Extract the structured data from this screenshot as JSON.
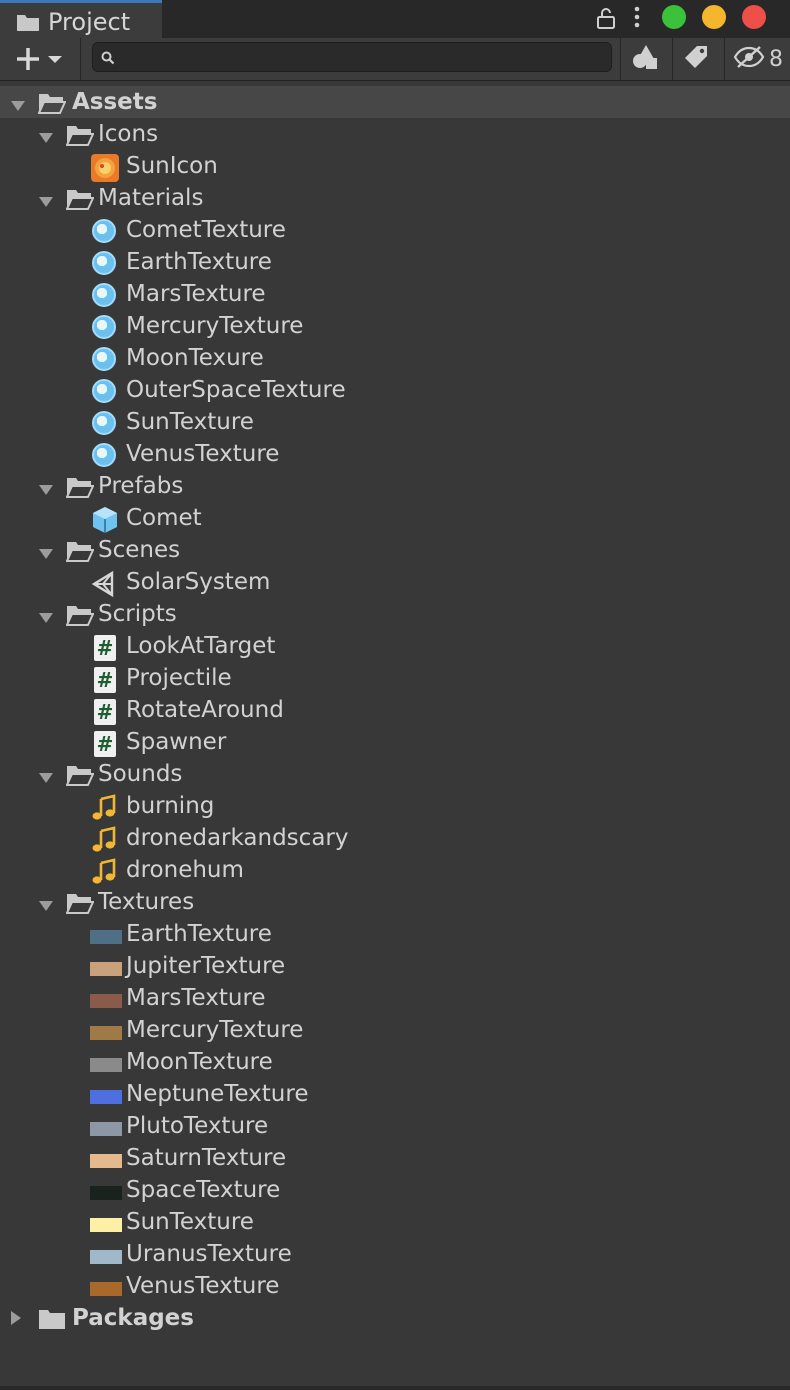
{
  "window": {
    "tab_title": "Project",
    "traffic_colors": {
      "green": "#3cc13b",
      "yellow": "#f5b62d",
      "red": "#ee4f48"
    }
  },
  "toolbar": {
    "search_placeholder": "",
    "hidden_count": "8"
  },
  "tree": [
    {
      "label": "Assets",
      "depth": 0,
      "kind": "folder",
      "expanded": true,
      "bold": true
    },
    {
      "label": "Icons",
      "depth": 1,
      "kind": "folder",
      "expanded": true
    },
    {
      "label": "SunIcon",
      "depth": 2,
      "kind": "image-icon"
    },
    {
      "label": "Materials",
      "depth": 1,
      "kind": "folder",
      "expanded": true
    },
    {
      "label": "CometTexture",
      "depth": 2,
      "kind": "material"
    },
    {
      "label": "EarthTexture",
      "depth": 2,
      "kind": "material"
    },
    {
      "label": "MarsTexture",
      "depth": 2,
      "kind": "material"
    },
    {
      "label": "MercuryTexture",
      "depth": 2,
      "kind": "material"
    },
    {
      "label": "MoonTexure",
      "depth": 2,
      "kind": "material"
    },
    {
      "label": "OuterSpaceTexture",
      "depth": 2,
      "kind": "material"
    },
    {
      "label": "SunTexture",
      "depth": 2,
      "kind": "material"
    },
    {
      "label": "VenusTexture",
      "depth": 2,
      "kind": "material"
    },
    {
      "label": "Prefabs",
      "depth": 1,
      "kind": "folder",
      "expanded": true
    },
    {
      "label": "Comet",
      "depth": 2,
      "kind": "prefab"
    },
    {
      "label": "Scenes",
      "depth": 1,
      "kind": "folder",
      "expanded": true
    },
    {
      "label": "SolarSystem",
      "depth": 2,
      "kind": "scene"
    },
    {
      "label": "Scripts",
      "depth": 1,
      "kind": "folder",
      "expanded": true
    },
    {
      "label": "LookAtTarget",
      "depth": 2,
      "kind": "script"
    },
    {
      "label": "Projectile",
      "depth": 2,
      "kind": "script"
    },
    {
      "label": "RotateAround",
      "depth": 2,
      "kind": "script"
    },
    {
      "label": "Spawner",
      "depth": 2,
      "kind": "script"
    },
    {
      "label": "Sounds",
      "depth": 1,
      "kind": "folder",
      "expanded": true
    },
    {
      "label": "burning",
      "depth": 2,
      "kind": "audio"
    },
    {
      "label": "dronedarkandscary",
      "depth": 2,
      "kind": "audio"
    },
    {
      "label": "dronehum",
      "depth": 2,
      "kind": "audio"
    },
    {
      "label": "Textures",
      "depth": 1,
      "kind": "folder",
      "expanded": true
    },
    {
      "label": "EarthTexture",
      "depth": 2,
      "kind": "texture",
      "color": "#4f6f86"
    },
    {
      "label": "JupiterTexture",
      "depth": 2,
      "kind": "texture",
      "color": "#c9a27c"
    },
    {
      "label": "MarsTexture",
      "depth": 2,
      "kind": "texture",
      "color": "#8a5a4a"
    },
    {
      "label": "MercuryTexture",
      "depth": 2,
      "kind": "texture",
      "color": "#a07a46"
    },
    {
      "label": "MoonTexture",
      "depth": 2,
      "kind": "texture",
      "color": "#8a8a8a"
    },
    {
      "label": "NeptuneTexture",
      "depth": 2,
      "kind": "texture",
      "color": "#4e6fe0"
    },
    {
      "label": "PlutoTexture",
      "depth": 2,
      "kind": "texture",
      "color": "#8c98a6"
    },
    {
      "label": "SaturnTexture",
      "depth": 2,
      "kind": "texture",
      "color": "#e4b98e"
    },
    {
      "label": "SpaceTexture",
      "depth": 2,
      "kind": "texture",
      "color": "#1a221e"
    },
    {
      "label": "SunTexture",
      "depth": 2,
      "kind": "texture",
      "color": "#fbf0a6"
    },
    {
      "label": "UranusTexture",
      "depth": 2,
      "kind": "texture",
      "color": "#9fb9c8"
    },
    {
      "label": "VenusTexture",
      "depth": 2,
      "kind": "texture",
      "color": "#a8692a"
    },
    {
      "label": "Packages",
      "depth": 0,
      "kind": "folder",
      "expanded": false,
      "bold": true
    }
  ]
}
